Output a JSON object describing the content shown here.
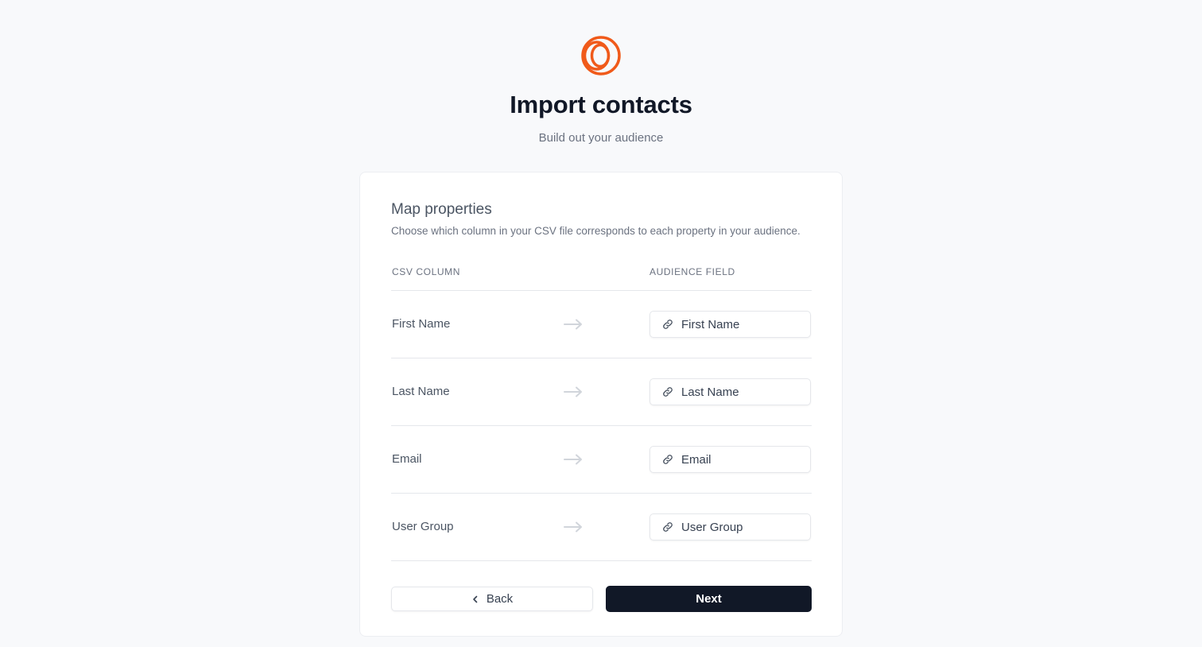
{
  "header": {
    "logo_icon": "interlocking-rings-logo",
    "brand_color": "#f05a1a",
    "title": "Import contacts",
    "subtitle": "Build out your audience"
  },
  "card": {
    "title": "Map properties",
    "description": "Choose which column in your CSV file corresponds to each property in your audience.",
    "columns": {
      "csv": "CSV COLUMN",
      "audience": "AUDIENCE FIELD"
    },
    "mappings": [
      {
        "csv_column": "First Name",
        "audience_field": "First Name"
      },
      {
        "csv_column": "Last Name",
        "audience_field": "Last Name"
      },
      {
        "csv_column": "Email",
        "audience_field": "Email"
      },
      {
        "csv_column": "User Group",
        "audience_field": "User Group"
      }
    ],
    "row_icons": {
      "arrow": "arrow-right-icon",
      "field": "link-icon"
    }
  },
  "actions": {
    "back_label": "Back",
    "next_label": "Next",
    "next_bg": "#111827"
  }
}
